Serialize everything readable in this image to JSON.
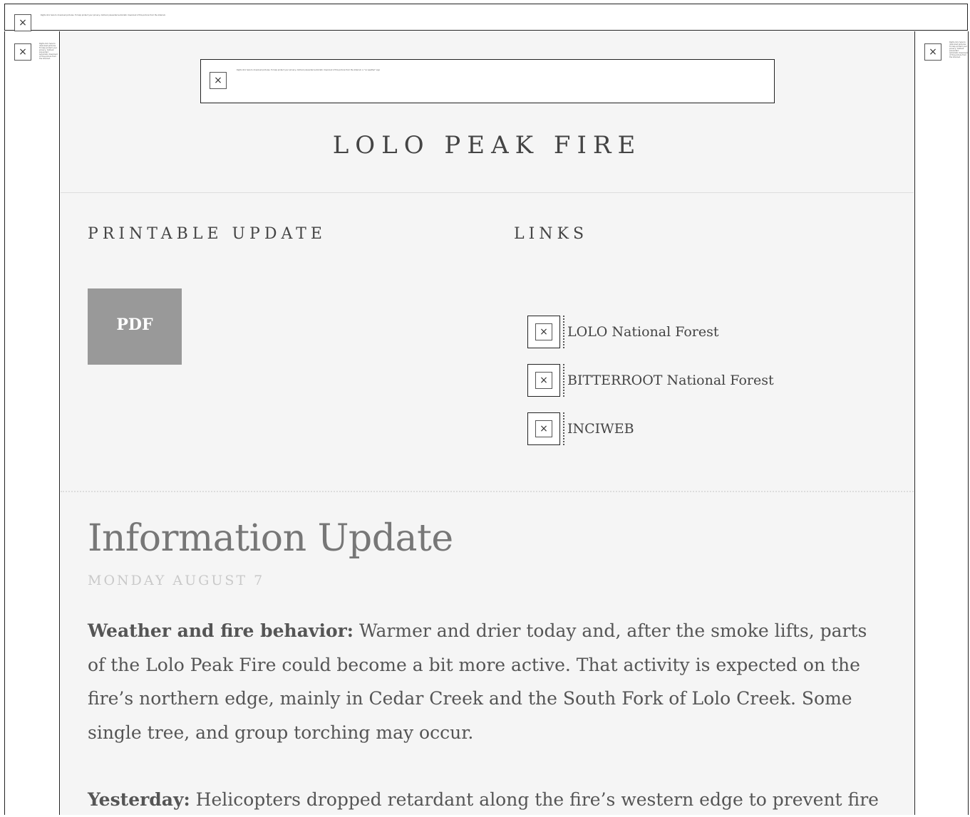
{
  "site": {
    "title": "LOLO PEAK FIRE"
  },
  "sections": {
    "printable_update": {
      "heading": "PRINTABLE UPDATE",
      "button_label": "PDF"
    },
    "links": {
      "heading": "LINKS",
      "items": [
        {
          "label": "LOLO National Forest",
          "icon": "broken-image-icon"
        },
        {
          "label": "BITTERROOT National Forest",
          "icon": "broken-image-icon"
        },
        {
          "label": "INCIWEB",
          "icon": "broken-image-icon"
        }
      ]
    }
  },
  "article": {
    "title": "Information Update",
    "date": "MONDAY AUGUST 7",
    "paragraphs": [
      {
        "lead": "Weather and fire behavior:",
        "text": " Warmer and drier today and, after the smoke lifts, parts of the Lolo Peak Fire could become a bit more active. That activity is expected on the fire’s northern edge, mainly in Cedar Creek and the South Fork of Lolo Creek. Some single tree, and group torching may occur."
      },
      {
        "lead": "Yesterday:",
        "text": " Helicopters dropped retardant along the fire’s western edge to prevent fire"
      }
    ]
  },
  "placeholders": {
    "close_glyph": "×",
    "banner_text": "Right-click here to download pictures. To help protect your privacy, Outlook prevented automatic download of this picture from the Internet.",
    "inner_banner_text": "Right-click here to download pictures. To help protect your privacy, Outlook prevented automatic download of this picture from the Internet. A \"no weather\" sign"
  },
  "colors": {
    "page_bg": "#f5f5f5",
    "pdf_button_bg": "#999999",
    "text": "#555555"
  }
}
